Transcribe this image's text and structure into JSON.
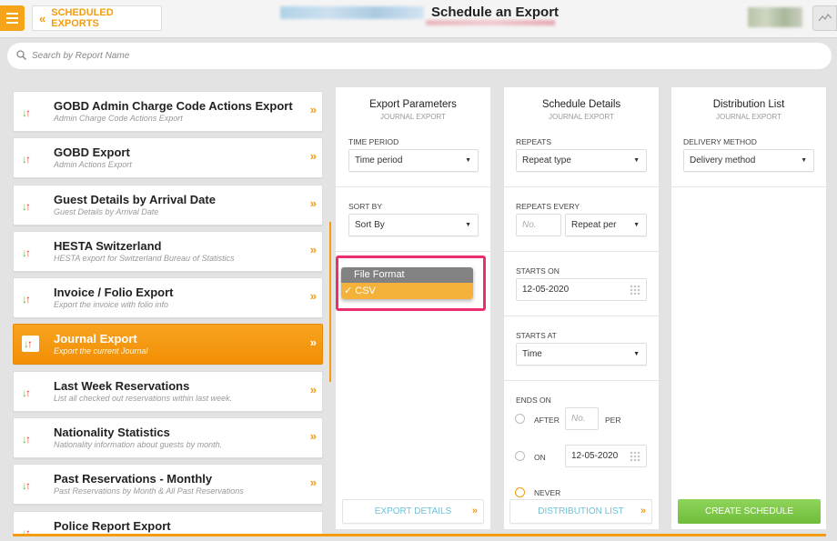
{
  "header": {
    "back_label": "SCHEDULED EXPORTS",
    "title": "Schedule an Export"
  },
  "search": {
    "placeholder": "Search by Report Name"
  },
  "reports": [
    {
      "title": "GOBD Admin Charge Code Actions Export",
      "subtitle": "Admin Charge Code Actions Export",
      "active": false
    },
    {
      "title": "GOBD Export",
      "subtitle": "Admin Actions Export",
      "active": false
    },
    {
      "title": "Guest Details by Arrival Date",
      "subtitle": "Guest Details by Arrival Date",
      "active": false
    },
    {
      "title": "HESTA Switzerland",
      "subtitle": "HESTA export for Switzerland Bureau of Statistics",
      "active": false
    },
    {
      "title": "Invoice / Folio Export",
      "subtitle": "Export the invoice with folio info",
      "active": false
    },
    {
      "title": "Journal Export",
      "subtitle": "Export the current Journal",
      "active": true
    },
    {
      "title": "Last Week Reservations",
      "subtitle": "List all checked out reservations within last week.",
      "active": false
    },
    {
      "title": "Nationality Statistics",
      "subtitle": "Nationality information about guests by month.",
      "active": false
    },
    {
      "title": "Past Reservations - Monthly",
      "subtitle": "Past Reservations by Month & All Past Reservations",
      "active": false
    },
    {
      "title": "Police Report Export",
      "subtitle": "",
      "active": false
    }
  ],
  "export_params": {
    "title": "Export Parameters",
    "subtitle": "JOURNAL EXPORT",
    "time_period_label": "TIME PERIOD",
    "time_period_value": "Time period",
    "sort_by_label": "SORT BY",
    "sort_by_value": "Sort By",
    "file_format_options": [
      "File Format",
      "✓ CSV"
    ],
    "footer_button": "EXPORT DETAILS"
  },
  "schedule": {
    "title": "Schedule Details",
    "subtitle": "JOURNAL EXPORT",
    "repeats_label": "REPEATS",
    "repeats_value": "Repeat type",
    "repeats_every_label": "REPEATS EVERY",
    "repeats_every_placeholder": "No.",
    "repeats_per_value": "Repeat per",
    "starts_on_label": "STARTS ON",
    "starts_on_value": "12-05-2020",
    "starts_at_label": "STARTS AT",
    "starts_at_value": "Time",
    "ends_on_label": "ENDS ON",
    "after_label": "AFTER",
    "after_placeholder": "No.",
    "per_label": "PER",
    "on_label": "ON",
    "on_value": "12-05-2020",
    "never_label": "NEVER",
    "footer_button": "DISTRIBUTION LIST"
  },
  "distribution": {
    "title": "Distribution List",
    "subtitle": "JOURNAL EXPORT",
    "delivery_label": "DELIVERY METHOD",
    "delivery_value": "Delivery method",
    "create_button": "CREATE SCHEDULE"
  },
  "colors": {
    "accent": "#f39c12",
    "create": "#7ac943",
    "highlight": "#ec2e6f"
  }
}
